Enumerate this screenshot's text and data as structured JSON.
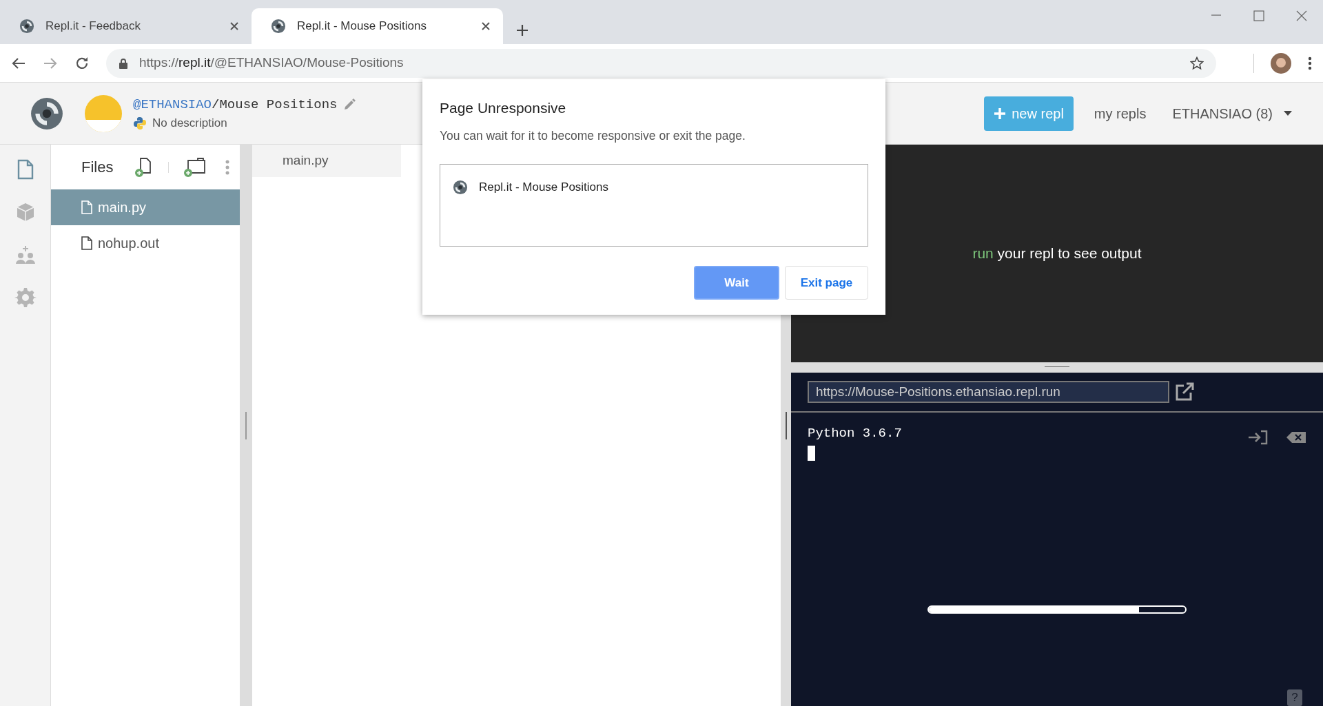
{
  "browser": {
    "tabs": [
      {
        "title": "Repl.it - Feedback",
        "selected": false
      },
      {
        "title": "Repl.it - Mouse Positions",
        "selected": true
      }
    ],
    "address": {
      "scheme": "https://",
      "host": "repl.it",
      "path": "/@ETHANSIAO/Mouse-Positions"
    }
  },
  "header": {
    "owner": "@ETHANSIAO",
    "separator": "/",
    "repl_name": "Mouse Positions",
    "description": "No description",
    "new_button": "new repl",
    "my_repls": "my repls",
    "user": "ETHANSIAO (8)"
  },
  "rail": [
    {
      "kind": "files",
      "selected": true
    },
    {
      "kind": "packages",
      "selected": false
    },
    {
      "kind": "multiplayer",
      "selected": false
    },
    {
      "kind": "settings",
      "selected": false
    }
  ],
  "files": {
    "title": "Files",
    "items": [
      {
        "name": "main.py",
        "selected": true
      },
      {
        "name": "nohup.out",
        "selected": false
      }
    ]
  },
  "editor": {
    "tab": "main.py"
  },
  "output": {
    "hint_keyword": "run",
    "hint_text": "your repl to see output",
    "url": "https://Mouse-Positions.ethansiao.repl.run",
    "console_lines": [
      "Python 3.6.7"
    ],
    "progress": {
      "level": 0.82
    },
    "help": "?"
  },
  "dialog": {
    "title": "Page Unresponsive",
    "message": "You can wait for it to become responsive or exit the page.",
    "pages": [
      "Repl.it - Mouse Positions"
    ],
    "buttons": [
      {
        "label": "Wait",
        "selected": true
      },
      {
        "label": "Exit page",
        "selected": false
      }
    ]
  }
}
